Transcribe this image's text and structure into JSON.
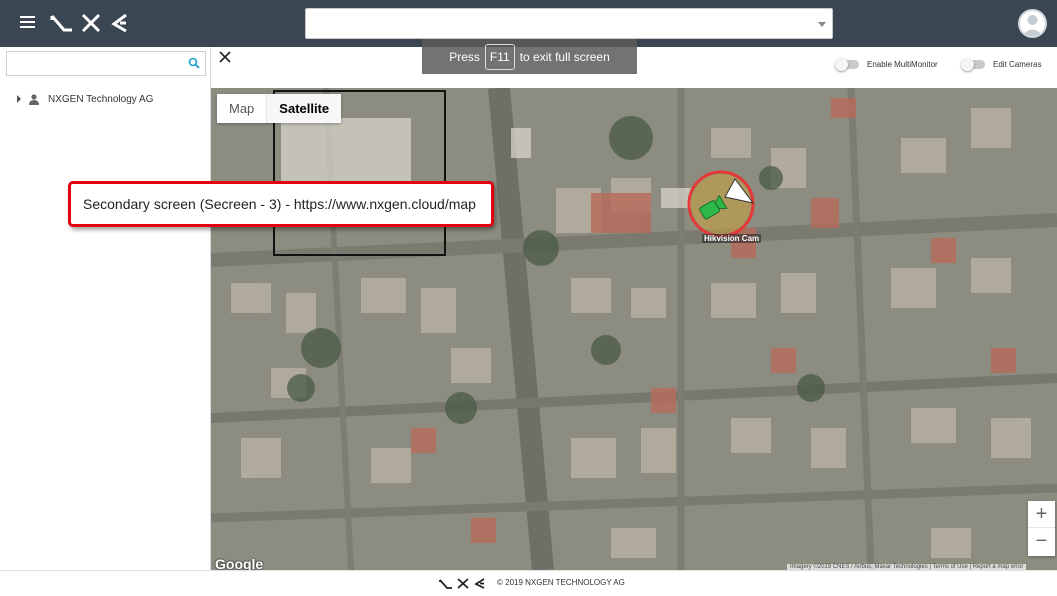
{
  "header": {
    "brand": "NXG",
    "search_value": ""
  },
  "sidebar": {
    "search_value": "",
    "tree": [
      {
        "label": "NXGEN Technology AG"
      }
    ]
  },
  "main": {
    "fullscreen_notice": {
      "prefix": "Press",
      "key": "F11",
      "suffix": "to exit full screen"
    },
    "toggles": [
      {
        "label": "Enable MultiMonitor",
        "on": false
      },
      {
        "label": "Edit Cameras",
        "on": false
      }
    ],
    "map": {
      "type_buttons": [
        "Map",
        "Satellite"
      ],
      "active_type": "Satellite",
      "camera": {
        "label": "Hikvision Cam"
      },
      "zoom_in": "+",
      "zoom_out": "−",
      "provider": "Google",
      "attribution": "Imagery ©2019 CNES / Airbus, Maxar Technologies | Terms of Use | Report a map error"
    }
  },
  "callout": {
    "text": "Secondary screen (Secreen - 3) - https://www.nxgen.cloud/map"
  },
  "footer": {
    "copyright": "© 2019 NXGEN TECHNOLOGY AG"
  },
  "colors": {
    "header_bg": "#3a4753",
    "callout_border": "#e3000f",
    "camera_ring": "#e53935",
    "camera_icon": "#2fb84a"
  }
}
